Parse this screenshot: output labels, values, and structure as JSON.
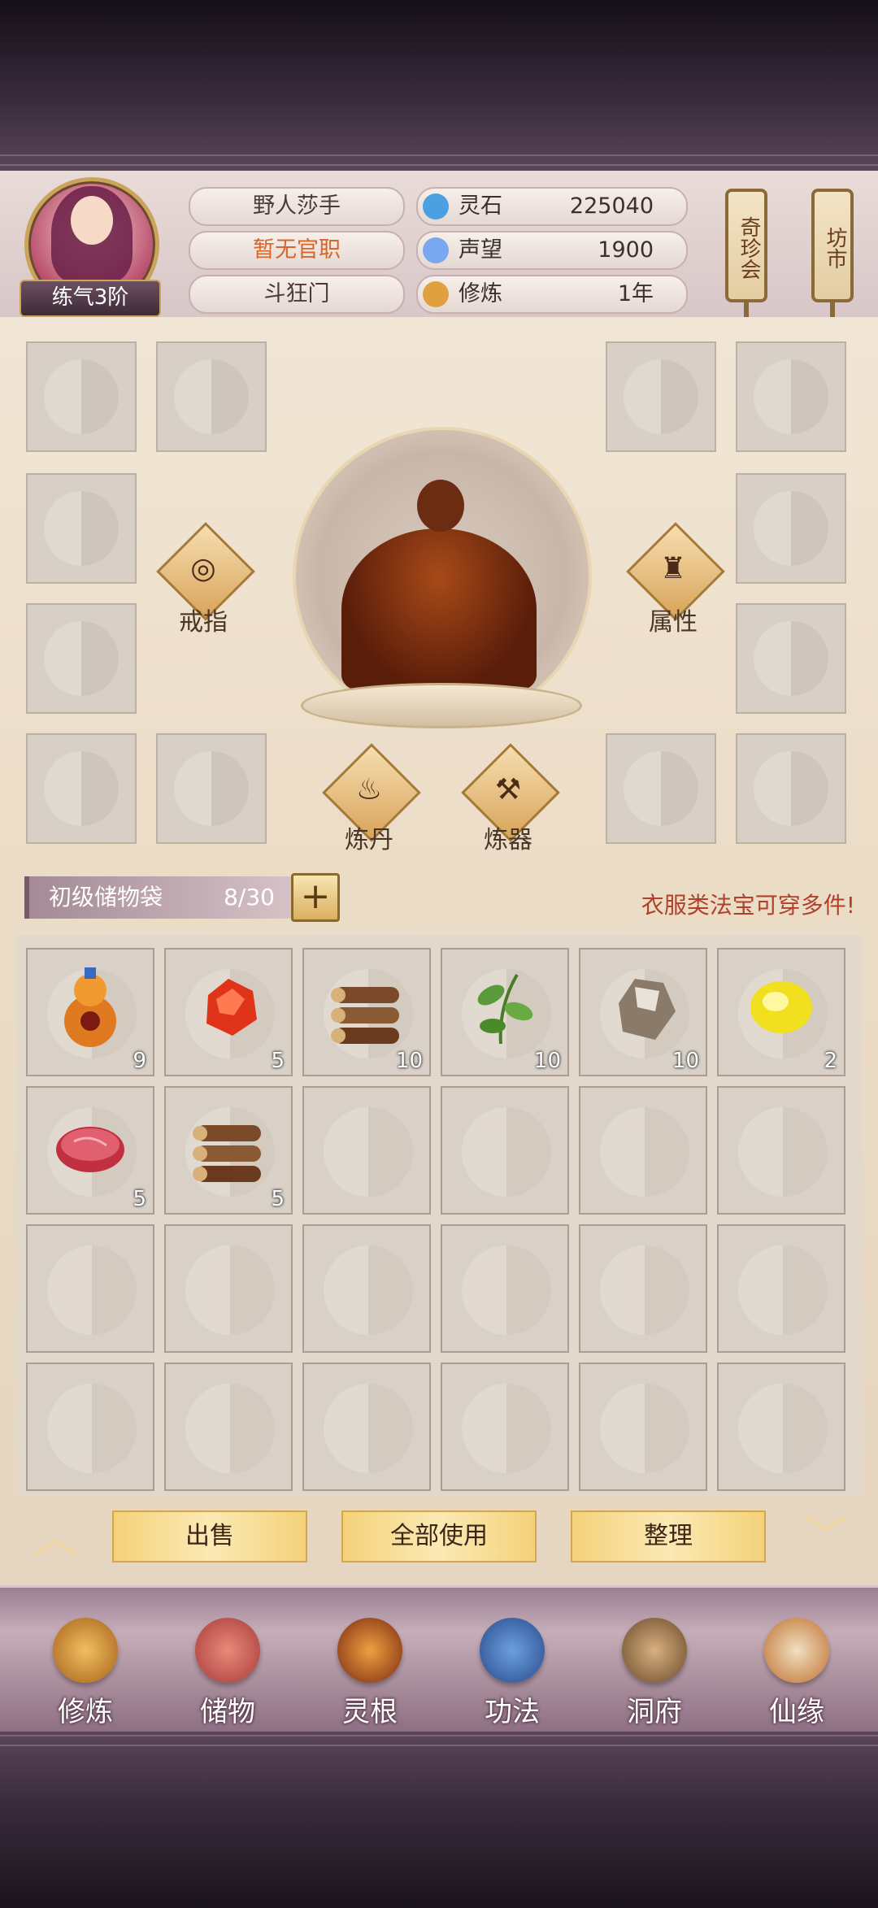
{
  "header": {
    "rank": "练气3阶",
    "name": "野人莎手",
    "title": "暂无官职",
    "sect": "斗狂门",
    "stats": [
      {
        "label": "灵石",
        "value": "225040",
        "icon": "spirit-stone-icon",
        "color": "#4aa0e0"
      },
      {
        "label": "声望",
        "value": "1900",
        "icon": "prestige-crystal-icon",
        "color": "#7aa8f0"
      },
      {
        "label": "修炼",
        "value": "1年",
        "icon": "meditation-icon",
        "color": "#e0a040"
      }
    ],
    "lanterns": [
      "奇珍会",
      "坊市"
    ]
  },
  "equipment": {
    "ring_label": "戒指",
    "attributes_label": "属性",
    "alchemy_label": "炼丹",
    "forge_label": "炼器"
  },
  "storage": {
    "bag_name": "初级储物袋",
    "capacity": "8/30",
    "add_symbol": "+",
    "hint": "衣服类法宝可穿多件!",
    "items": [
      {
        "icon": "gourd-icon",
        "qty": "9"
      },
      {
        "icon": "red-gem-icon",
        "qty": "5"
      },
      {
        "icon": "wood-logs-icon",
        "qty": "10"
      },
      {
        "icon": "herb-leaf-icon",
        "qty": "10"
      },
      {
        "icon": "ore-stone-icon",
        "qty": "10"
      },
      {
        "icon": "yellow-gem-icon",
        "qty": "2"
      },
      {
        "icon": "raw-meat-icon",
        "qty": "5"
      },
      {
        "icon": "wood-logs-icon",
        "qty": "5"
      }
    ]
  },
  "actions": {
    "sell": "出售",
    "use_all": "全部使用",
    "organize": "整理"
  },
  "nav": [
    {
      "label": "修炼",
      "icon": "cultivate-icon"
    },
    {
      "label": "储物",
      "icon": "storage-bag-icon"
    },
    {
      "label": "灵根",
      "icon": "spirit-root-icon"
    },
    {
      "label": "功法",
      "icon": "technique-book-icon"
    },
    {
      "label": "洞府",
      "icon": "cave-dwelling-icon"
    },
    {
      "label": "仙缘",
      "icon": "immortal-fate-icon"
    }
  ]
}
